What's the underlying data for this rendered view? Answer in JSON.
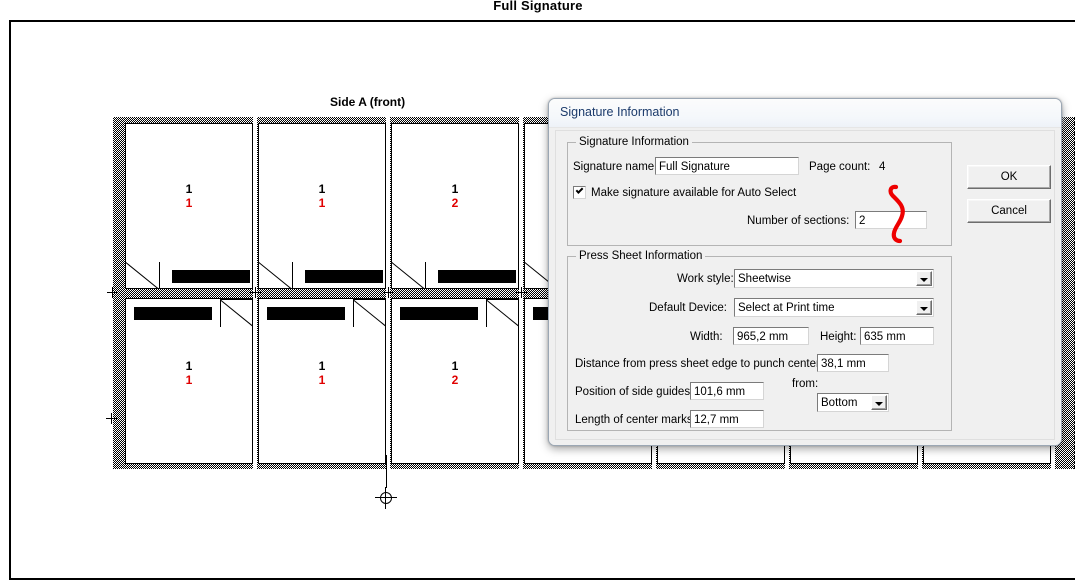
{
  "document": {
    "title": "Full Signature"
  },
  "imposition": {
    "side_label": "Side A (front)",
    "pages": [
      {
        "row": "top",
        "col": 1,
        "black": "1",
        "red": "1"
      },
      {
        "row": "top",
        "col": 2,
        "black": "1",
        "red": "1"
      },
      {
        "row": "top",
        "col": 3,
        "black": "1",
        "red": "2"
      },
      {
        "row": "bottom",
        "col": 1,
        "black": "1",
        "red": "1"
      },
      {
        "row": "bottom",
        "col": 2,
        "black": "1",
        "red": "1"
      },
      {
        "row": "bottom",
        "col": 3,
        "black": "1",
        "red": "2"
      }
    ]
  },
  "dialog": {
    "title": "Signature Information",
    "signature_group": {
      "title": "Signature Information",
      "name_label": "Signature name:",
      "name_value": "Full Signature",
      "page_count_label": "Page count:",
      "page_count_value": "4",
      "auto_select_label": "Make signature available for Auto Select",
      "auto_select_checked": true,
      "sections_label": "Number of sections:",
      "sections_value": "2"
    },
    "press_group": {
      "title": "Press Sheet Information",
      "work_style_label": "Work style:",
      "work_style_value": "Sheetwise",
      "default_device_label": "Default Device:",
      "default_device_value": "Select at Print time",
      "width_label": "Width:",
      "width_value": "965,2 mm",
      "height_label": "Height:",
      "height_value": "635 mm",
      "punch_label": "Distance from press sheet edge to punch center:",
      "punch_value": "38,1 mm",
      "side_guides_label": "Position of side guides:",
      "side_guides_value": "101,6 mm",
      "from_label": "from:",
      "from_value": "Bottom",
      "center_marks_label": "Length of center marks:",
      "center_marks_value": "12,7 mm"
    },
    "buttons": {
      "ok": "OK",
      "cancel": "Cancel"
    }
  },
  "annotation": {
    "color": "#ee0000",
    "shape": "handwritten-squiggle"
  },
  "colors": {
    "page_number_black": "#000000",
    "page_number_red": "#e00000",
    "dialog_face": "#f0f0f0",
    "title_text": "#1b3a6b"
  }
}
